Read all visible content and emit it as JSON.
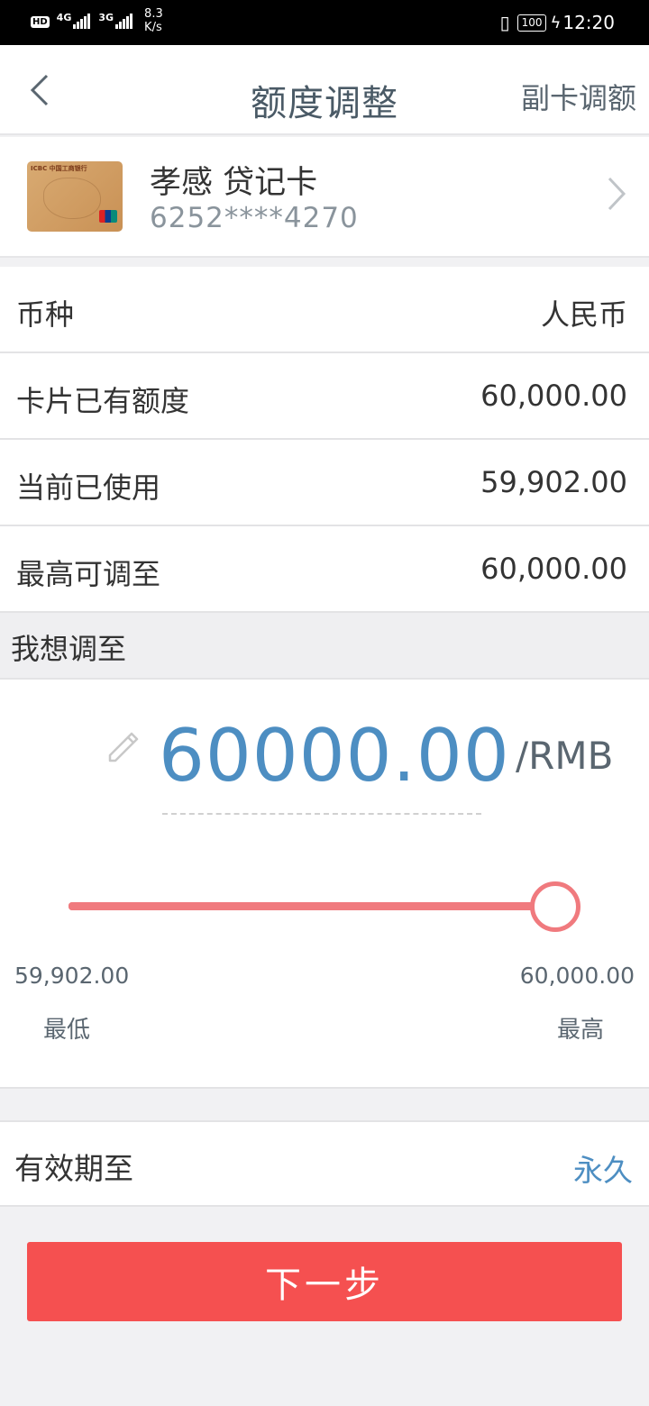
{
  "status_bar": {
    "hd": "HD",
    "net1": "4G",
    "net2": "3G",
    "speed_value": "8.3",
    "speed_unit": "K/s",
    "battery": "100",
    "time": "12:20"
  },
  "header": {
    "title": "额度调整",
    "right_action": "副卡调额"
  },
  "card": {
    "name": "孝感 贷记卡",
    "number": "6252****4270",
    "logo_text": "ICBC 中国工商银行"
  },
  "info_rows": [
    {
      "label": "币种",
      "value": "人民币"
    },
    {
      "label": "卡片已有额度",
      "value": "60,000.00"
    },
    {
      "label": "当前已使用",
      "value": "59,902.00"
    },
    {
      "label": "最高可调至",
      "value": "60,000.00"
    }
  ],
  "adjust": {
    "section_label": "我想调至",
    "amount": "60000.00",
    "unit": "/RMB",
    "slider_fraction": 1.0,
    "min_value": "59,902.00",
    "max_value": "60,000.00",
    "min_label": "最低",
    "max_label": "最高"
  },
  "validity": {
    "label": "有效期至",
    "value": "永久"
  },
  "next_button": "下一步",
  "colors": {
    "accent_blue": "#4d8ec2",
    "slider_red": "#f07a7e",
    "button_red": "#f55050"
  }
}
